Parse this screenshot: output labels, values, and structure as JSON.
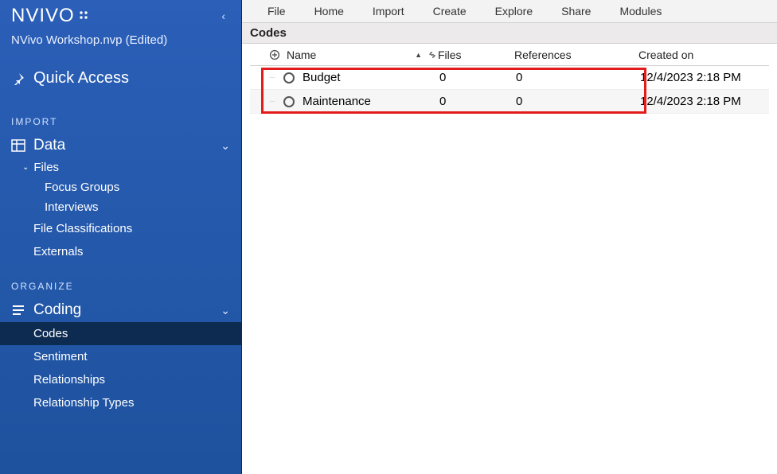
{
  "brand": "NVIVO",
  "project_name": "NVivo Workshop.nvp (Edited)",
  "quick_access": "Quick Access",
  "sections": {
    "import": "IMPORT",
    "organize": "ORGANIZE"
  },
  "nav": {
    "data": {
      "label": "Data",
      "files": "Files",
      "focus_groups": "Focus Groups",
      "interviews": "Interviews",
      "file_classifications": "File Classifications",
      "externals": "Externals"
    },
    "coding": {
      "label": "Coding",
      "codes": "Codes",
      "sentiment": "Sentiment",
      "relationships": "Relationships",
      "relationship_types": "Relationship Types"
    }
  },
  "menu": [
    "File",
    "Home",
    "Import",
    "Create",
    "Explore",
    "Share",
    "Modules"
  ],
  "panel_title": "Codes",
  "columns": {
    "name": "Name",
    "files": "Files",
    "references": "References",
    "created_on": "Created on"
  },
  "rows": [
    {
      "name": "Budget",
      "files": "0",
      "references": "0",
      "created_on": "12/4/2023 2:18 PM"
    },
    {
      "name": "Maintenance",
      "files": "0",
      "references": "0",
      "created_on": "12/4/2023 2:18 PM"
    }
  ]
}
